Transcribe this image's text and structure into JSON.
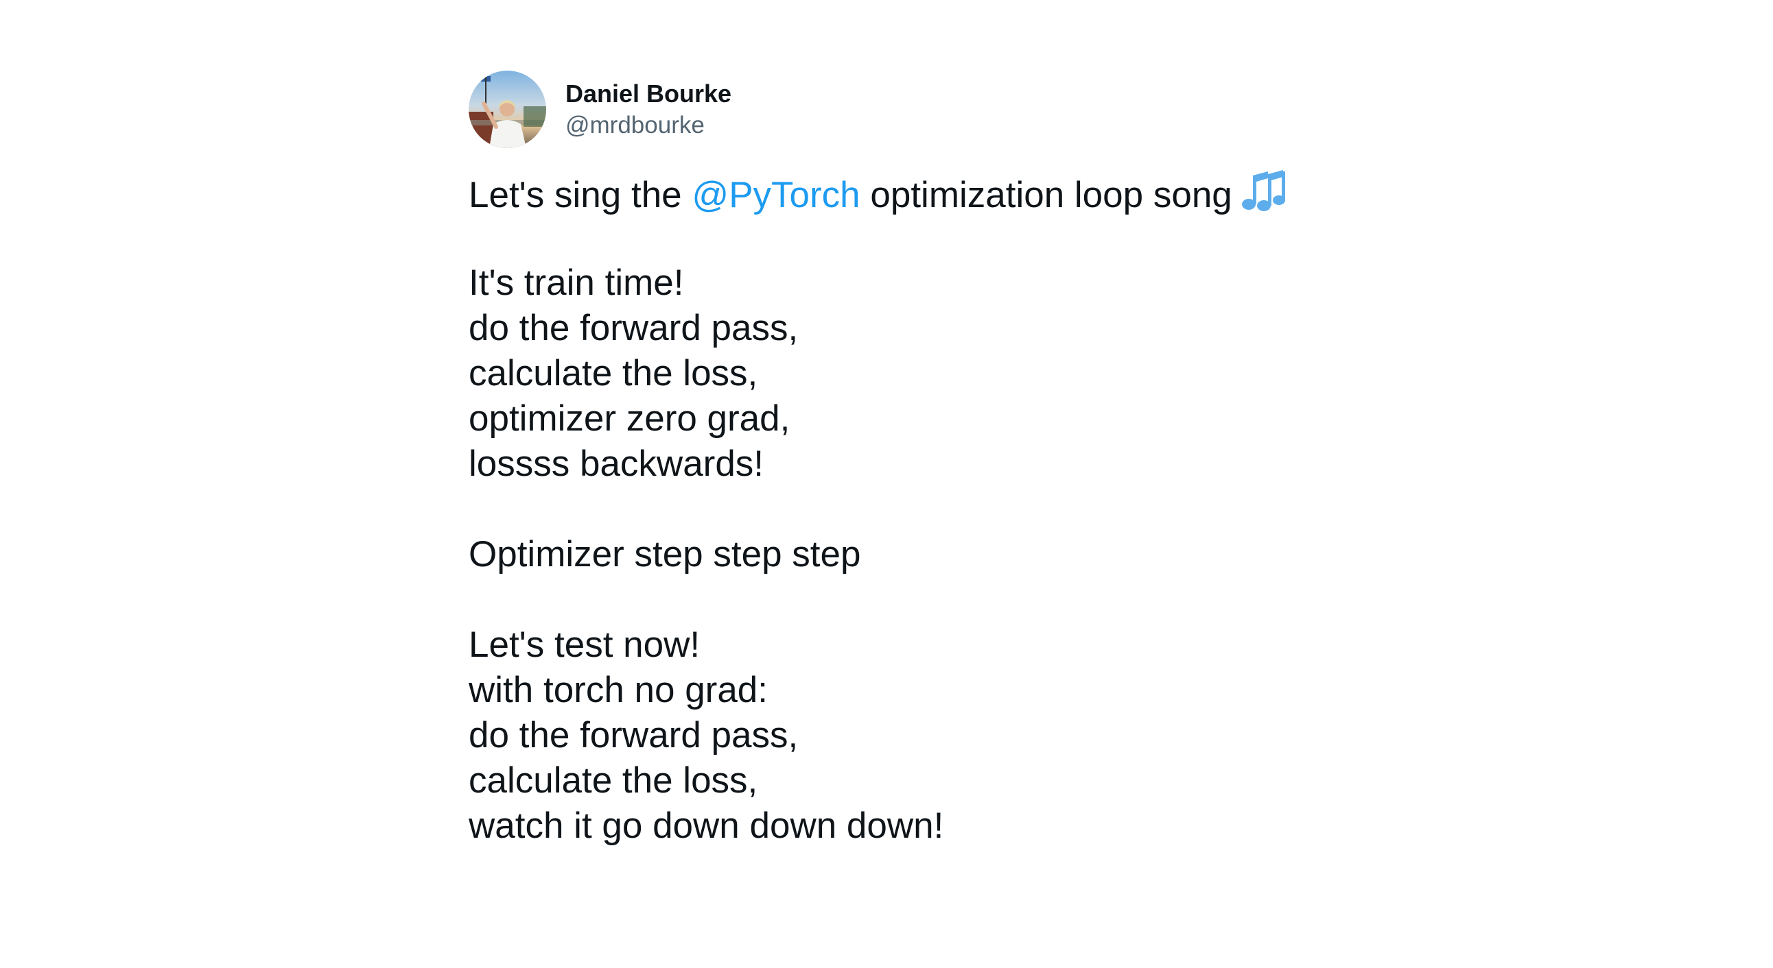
{
  "tweet": {
    "author": {
      "display_name": "Daniel Bourke",
      "handle": "@mrdbourke",
      "avatar_icon": "profile-photo"
    },
    "first_line": {
      "before": "Let's sing the ",
      "mention": "@PyTorch",
      "after": " optimization loop song",
      "emoji_icon": "musical-notes-icon"
    },
    "lines": [
      "It's train time!",
      "do the forward pass,",
      "calculate the loss,",
      "optimizer zero grad,",
      "lossss backwards!",
      "Optimizer step step step",
      "Let's test now!",
      "with torch no grad:",
      "do the forward pass,",
      "calculate the loss,",
      "watch it go down down down!"
    ],
    "colors": {
      "mention": "#1d9bf0",
      "text": "#0f1419",
      "handle": "#536471",
      "emoji": "#5dadec"
    }
  }
}
